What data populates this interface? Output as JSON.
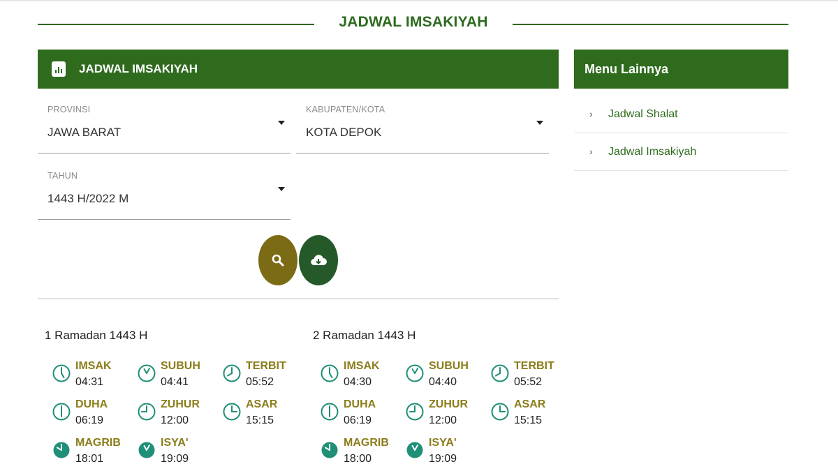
{
  "page": {
    "title": "JADWAL IMSAKIYAH"
  },
  "panel": {
    "title": "JADWAL IMSAKIYAH",
    "icon": "bar-chart-icon"
  },
  "form": {
    "provinsi": {
      "label": "PROVINSI",
      "value": "JAWA BARAT"
    },
    "kabupaten": {
      "label": "KABUPATEN/KOTA",
      "value": "KOTA DEPOK"
    },
    "tahun": {
      "label": "TAHUN",
      "value": "1443 H/2022 M"
    }
  },
  "actions": {
    "search_icon": "search-icon",
    "download_icon": "cloud-download-icon"
  },
  "days": [
    {
      "title": "1 Ramadan 1443 H",
      "times": [
        {
          "name": "IMSAK",
          "time": "04:31"
        },
        {
          "name": "SUBUH",
          "time": "04:41"
        },
        {
          "name": "TERBIT",
          "time": "05:52"
        },
        {
          "name": "DUHA",
          "time": "06:19"
        },
        {
          "name": "ZUHUR",
          "time": "12:00"
        },
        {
          "name": "ASAR",
          "time": "15:15"
        },
        {
          "name": "MAGRIB",
          "time": "18:01"
        },
        {
          "name": "ISYA'",
          "time": "19:09"
        }
      ]
    },
    {
      "title": "2 Ramadan 1443 H",
      "times": [
        {
          "name": "IMSAK",
          "time": "04:30"
        },
        {
          "name": "SUBUH",
          "time": "04:40"
        },
        {
          "name": "TERBIT",
          "time": "05:52"
        },
        {
          "name": "DUHA",
          "time": "06:19"
        },
        {
          "name": "ZUHUR",
          "time": "12:00"
        },
        {
          "name": "ASAR",
          "time": "15:15"
        },
        {
          "name": "MAGRIB",
          "time": "18:00"
        },
        {
          "name": "ISYA'",
          "time": "19:09"
        }
      ]
    }
  ],
  "sidebar": {
    "title": "Menu Lainnya",
    "items": [
      {
        "label": "Jadwal Shalat"
      },
      {
        "label": "Jadwal Imsakiyah"
      }
    ]
  },
  "colors": {
    "primary": "#2e6b1d",
    "accent": "#8b7d1a",
    "search_button": "#7c6b15",
    "download_button": "#25592a",
    "clock": "#1f8f78"
  }
}
